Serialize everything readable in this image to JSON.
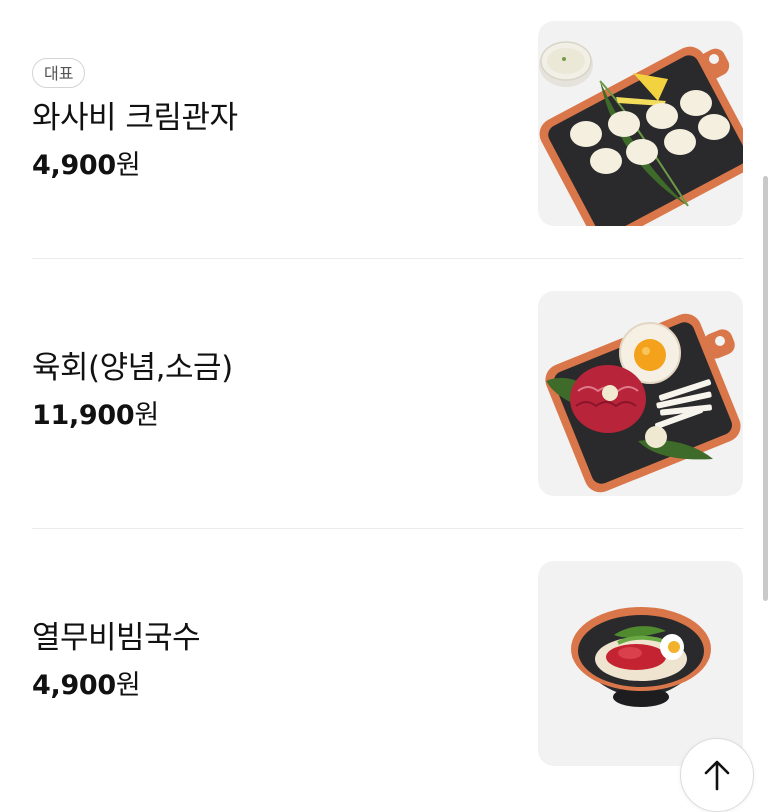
{
  "menu": {
    "items": [
      {
        "badge": "대표",
        "name": "와사비 크림관자",
        "price_number": "4,900",
        "price_unit": "원",
        "image_icon": "scallop-platter-photo"
      },
      {
        "badge": "",
        "name": "육회(양념,소금)",
        "price_number": "11,900",
        "price_unit": "원",
        "image_icon": "beef-tartare-platter-photo"
      },
      {
        "badge": "",
        "name": "열무비빔국수",
        "price_number": "4,900",
        "price_unit": "원",
        "image_icon": "bibim-noodle-bowl-photo"
      }
    ]
  },
  "scroll_top_button": {
    "icon": "arrow-up-icon"
  },
  "colors": {
    "text": "#111111",
    "badge_border": "#d4d4d4",
    "thumb_bg": "#f2f2f2",
    "divider": "#ebebeb",
    "platter_orange": "#d9774a",
    "platter_dark": "#2a2a2c"
  }
}
